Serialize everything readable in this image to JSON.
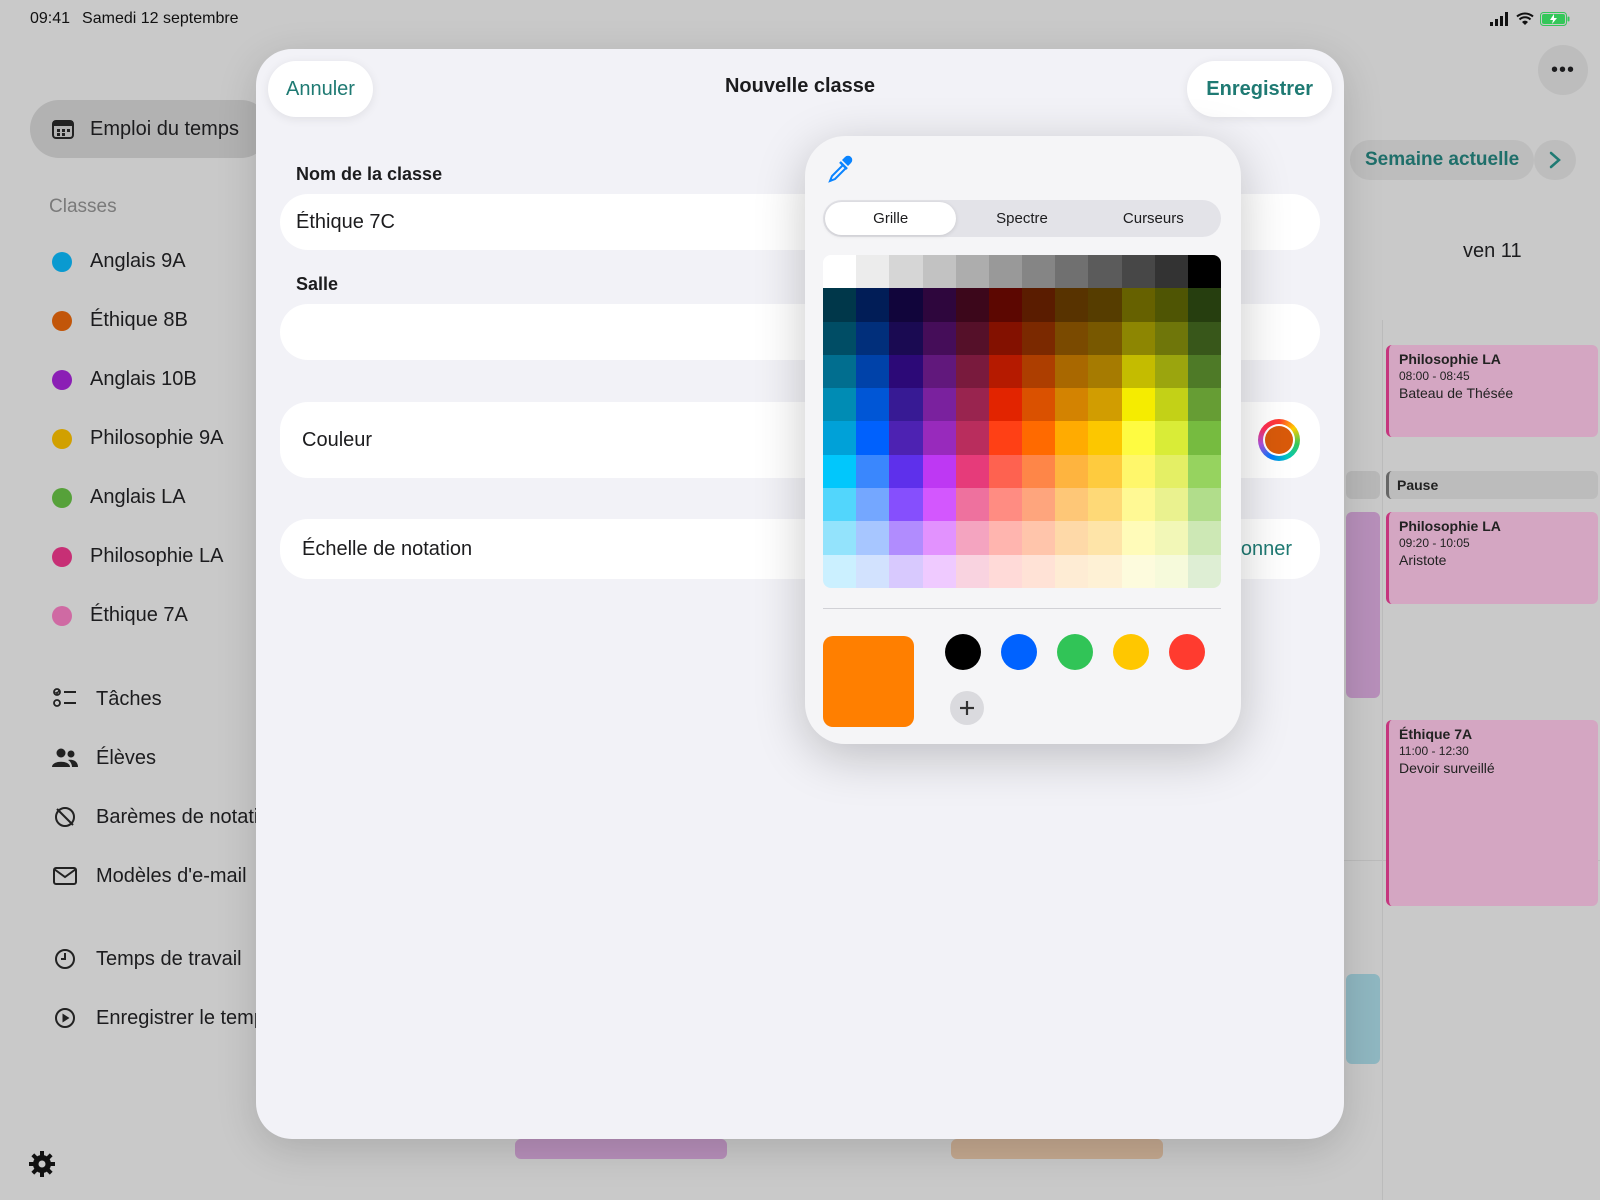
{
  "status_bar": {
    "time": "09:41",
    "date": "Samedi 12 septembre"
  },
  "sidebar": {
    "selected": "Emploi du temps",
    "section_title": "Classes",
    "classes": [
      {
        "label": "Anglais 9A",
        "color": "#0a9ad0"
      },
      {
        "label": "Éthique 8B",
        "color": "#c2560a"
      },
      {
        "label": "Anglais 10B",
        "color": "#8b1fb5"
      },
      {
        "label": "Philosophie 9A",
        "color": "#d1a000"
      },
      {
        "label": "Anglais LA",
        "color": "#56a13a"
      },
      {
        "label": "Philosophie LA",
        "color": "#c72f75"
      },
      {
        "label": "Éthique 7A",
        "color": "#cf6aa3"
      }
    ],
    "tools": [
      {
        "label": "Tâches",
        "icon": "checklist-icon"
      },
      {
        "label": "Élèves",
        "icon": "people-icon"
      },
      {
        "label": "Barèmes de notati",
        "icon": "grading-scale-icon"
      },
      {
        "label": "Modèles d'e-mail",
        "icon": "envelope-icon"
      }
    ],
    "time_items": [
      {
        "label": "Temps de travail",
        "icon": "clock-icon"
      },
      {
        "label": "Enregistrer le temp",
        "icon": "play-circle-icon"
      }
    ]
  },
  "calendar": {
    "week_button": "Semaine actuelle",
    "day_label": "ven 11",
    "events": [
      {
        "title": "Philosophie LA",
        "time": "08:00 - 08:45",
        "subtitle": "Bateau de Thésée"
      },
      {
        "title": "Pause"
      },
      {
        "title": "Philosophie LA",
        "time": "09:20 - 10:05",
        "subtitle": "Aristote"
      },
      {
        "title": "Éthique 7A",
        "time": "11:00 - 12:30",
        "subtitle": "Devoir surveillé"
      }
    ]
  },
  "sheet": {
    "cancel": "Annuler",
    "title": "Nouvelle classe",
    "save": "Enregistrer",
    "name_label": "Nom de la classe",
    "name_value": "Éthique 7C",
    "room_label": "Salle",
    "room_value": "",
    "color_label": "Couleur",
    "selected_color": "#d95a0b",
    "grading_label": "Échelle de notation",
    "grading_action": "tionner"
  },
  "color_picker": {
    "tabs": [
      "Grille",
      "Spectre",
      "Curseurs"
    ],
    "active_tab": "Grille",
    "current_color": "#ff7f00",
    "saved_colors": [
      "#000000",
      "#0062ff",
      "#31c457",
      "#ffc700",
      "#ff3b2f"
    ],
    "grid": [
      [
        "#ffffff",
        "#ececec",
        "#d6d6d6",
        "#c2c2c2",
        "#adadad",
        "#999999",
        "#858585",
        "#707070",
        "#5b5b5b",
        "#474747",
        "#333333",
        "#000000"
      ],
      [
        "#00374a",
        "#011d57",
        "#11053b",
        "#2e063d",
        "#3c071b",
        "#5c0701",
        "#5a1c00",
        "#583300",
        "#563d00",
        "#666100",
        "#4f5504",
        "#263e0f"
      ],
      [
        "#004d65",
        "#012f7b",
        "#1a0a52",
        "#450d59",
        "#551029",
        "#831100",
        "#7b2900",
        "#7a4a00",
        "#785800",
        "#8d8602",
        "#6f760a",
        "#38571a"
      ],
      [
        "#016e8f",
        "#0042a9",
        "#2c0977",
        "#61187c",
        "#791a3d",
        "#b51a00",
        "#ad3e00",
        "#a96800",
        "#a67b01",
        "#c4bc00",
        "#9ba50e",
        "#4e7a27"
      ],
      [
        "#008cb4",
        "#0056d6",
        "#371a94",
        "#7a219e",
        "#99244f",
        "#e22400",
        "#da5100",
        "#d38301",
        "#d19d01",
        "#f5ec00",
        "#c3d117",
        "#669d34"
      ],
      [
        "#00a1d8",
        "#0061fd",
        "#4d22b2",
        "#982abc",
        "#b92d5d",
        "#ff4015",
        "#ff6a00",
        "#ffab01",
        "#fcc700",
        "#fefb41",
        "#d9ec37",
        "#76bb40"
      ],
      [
        "#01c7fc",
        "#3a87fd",
        "#5e30eb",
        "#be38f3",
        "#e63b7a",
        "#fe6250",
        "#fe8648",
        "#feb43f",
        "#fecb3e",
        "#fff76b",
        "#e4ef65",
        "#96d35f"
      ],
      [
        "#52d6fc",
        "#74a7ff",
        "#864ffd",
        "#d357fe",
        "#ee719e",
        "#ff8c82",
        "#fea57d",
        "#fec777",
        "#fed977",
        "#fff994",
        "#eaf28f",
        "#b1dd8b"
      ],
      [
        "#93e3fc",
        "#a7c6ff",
        "#b18cfe",
        "#e292fe",
        "#f4a4c0",
        "#ffb5af",
        "#ffc5ab",
        "#fed9a8",
        "#fee4a8",
        "#fffbb9",
        "#f2f7b7",
        "#cde8b5"
      ],
      [
        "#cbf0ff",
        "#d2e2fe",
        "#d8c9fe",
        "#efcaff",
        "#f9d3e0",
        "#ffdad8",
        "#ffe2d6",
        "#feecd4",
        "#fef1d5",
        "#fdfbdd",
        "#f6fadb",
        "#deeed4"
      ]
    ]
  }
}
